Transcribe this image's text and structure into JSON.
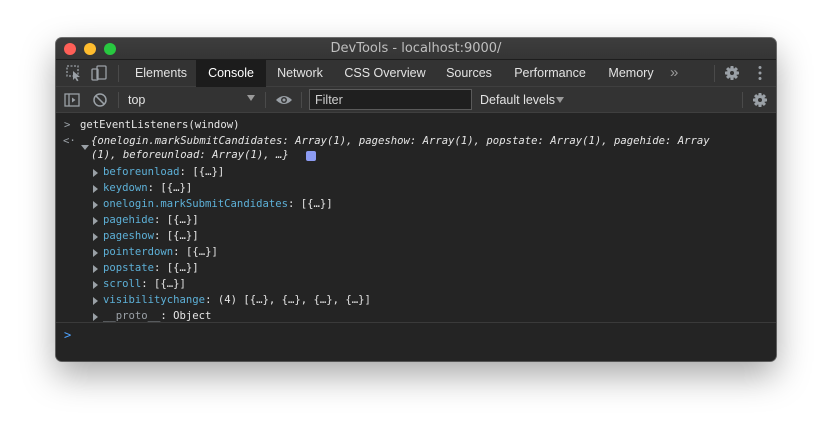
{
  "window": {
    "title": "DevTools - localhost:9000/"
  },
  "tabs": [
    {
      "label": "Elements"
    },
    {
      "label": "Console"
    },
    {
      "label": "Network"
    },
    {
      "label": "CSS Overview"
    },
    {
      "label": "Sources"
    },
    {
      "label": "Performance"
    },
    {
      "label": "Memory"
    }
  ],
  "more_tabs": "»",
  "toolbar": {
    "context": "top",
    "filter_placeholder": "Filter",
    "levels": "Default levels"
  },
  "console": {
    "command": "getEventListeners(window)",
    "result_line1": "{onelogin.markSubmitCandidates: Array(1), pageshow: Array(1), popstate: Array(1), pagehide: Array",
    "result_line2": "(1), beforeunload: Array(1), …}",
    "entries": [
      {
        "key": "beforeunload",
        "value": "[{…}]"
      },
      {
        "key": "keydown",
        "value": "[{…}]"
      },
      {
        "key": "onelogin.markSubmitCandidates",
        "value": "[{…}]"
      },
      {
        "key": "pagehide",
        "value": "[{…}]"
      },
      {
        "key": "pageshow",
        "value": "[{…}]"
      },
      {
        "key": "pointerdown",
        "value": "[{…}]"
      },
      {
        "key": "popstate",
        "value": "[{…}]"
      },
      {
        "key": "scroll",
        "value": "[{…}]"
      },
      {
        "key": "visibilitychange",
        "value": "(4) [{…}, {…}, {…}, {…}]"
      },
      {
        "key": "__proto__",
        "value": "Object"
      }
    ]
  },
  "colors": {
    "key": "#5db0d7",
    "proto_key": "#9aa0a6",
    "prompt": "#4fa3ff",
    "accent_badge": "#8c9bf2"
  },
  "icons": [
    "inspect-icon",
    "device-toggle-icon",
    "settings-gear-icon",
    "kebab-menu-icon",
    "sidebar-toggle-icon",
    "clear-console-icon",
    "eye-icon",
    "console-settings-gear-icon"
  ]
}
